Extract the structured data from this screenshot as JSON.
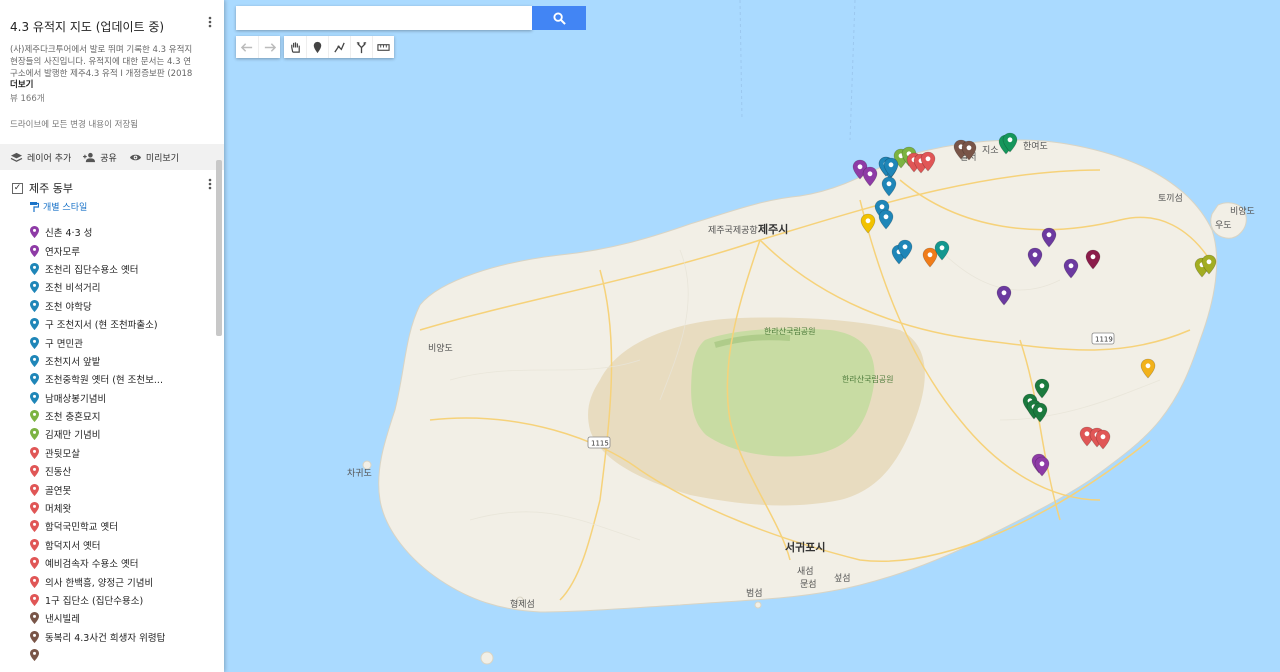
{
  "map_title": "4.3 유적지 지도 (업데이트 중)",
  "description": "(사)제주다크투어에서 발로 뛰며 기록한 4.3 유적지 현장들의 사진입니다. 유적지에 대한 문서는 4.3 연구소에서 발행한 제주4.3 유적 Ⅰ 개정증보판 (2018",
  "more_link": "더보기",
  "views": "뷰 166개",
  "saved_status": "드라이브에 모든 변경 내용이 저장됨",
  "actions": {
    "add_layer": "레이어 추가",
    "share": "공유",
    "preview": "미리보기"
  },
  "layer": {
    "name": "제주 동부",
    "checkbox": "✓",
    "style_link": "개별 스타일"
  },
  "items": [
    {
      "label": "신촌 4·3 성",
      "color": "#8e3ba6"
    },
    {
      "label": "연자모루",
      "color": "#8e3ba6"
    },
    {
      "label": "조천리 집단수용소 옛터",
      "color": "#1f86b8"
    },
    {
      "label": "조천 비석거리",
      "color": "#1f86b8"
    },
    {
      "label": "조천 야학당",
      "color": "#1f86b8"
    },
    {
      "label": "구 조천지서 (현 조천파출소)",
      "color": "#1f86b8"
    },
    {
      "label": "구 면민관",
      "color": "#1f86b8"
    },
    {
      "label": "조천지서 앞밭",
      "color": "#1f86b8"
    },
    {
      "label": "조천중학원 옛터 (현 조천보...",
      "color": "#1f86b8"
    },
    {
      "label": "남매상봉기념비",
      "color": "#1f86b8"
    },
    {
      "label": "조천 충혼묘지",
      "color": "#7cb342"
    },
    {
      "label": "김재만 기념비",
      "color": "#7cb342"
    },
    {
      "label": "관뒷모살",
      "color": "#e05656"
    },
    {
      "label": "진동산",
      "color": "#e05656"
    },
    {
      "label": "골연못",
      "color": "#e05656"
    },
    {
      "label": "머체왓",
      "color": "#e05656"
    },
    {
      "label": "함덕국민학교 옛터",
      "color": "#e05656"
    },
    {
      "label": "함덕지서 옛터",
      "color": "#e05656"
    },
    {
      "label": "예비검속자 수용소 옛터",
      "color": "#e05656"
    },
    {
      "label": "의사 한백흥, 양정근 기념비",
      "color": "#e05656"
    },
    {
      "label": "1구 집단소 (집단수용소)",
      "color": "#e05656"
    },
    {
      "label": "낸시빌레",
      "color": "#795548"
    },
    {
      "label": "동복리 4.3사건 희생자 위령탑",
      "color": "#795548"
    },
    {
      "label": "",
      "color": "#795548"
    }
  ],
  "search": {
    "placeholder": "",
    "value": ""
  },
  "tools": {
    "undo": "undo-icon",
    "redo": "redo-icon",
    "pan": "hand-icon",
    "marker": "marker-icon",
    "line": "draw-line-icon",
    "route": "directions-icon",
    "measure": "ruler-icon"
  },
  "map": {
    "labels": {
      "jeju_city": "제주시",
      "jeju_airport": "제주국제공항",
      "seogwipo": "서귀포시",
      "hallasan_np_1": "한라산국립공원",
      "hallasan_np_2": "한라산국립공원",
      "hamdeok": "함덕",
      "hanyeodo": "한여도",
      "tokkiseom": "토끼섬",
      "biyangdo_e": "비양도",
      "udo": "우도",
      "biyangdo_w": "비양도",
      "chagwido": "차귀도",
      "hyeongjeseom": "형제섬",
      "beomseom": "범섬",
      "munseom": "문섬",
      "seopseom": "섶섬",
      "saeseom": "새섬",
      "road_1115": "1115",
      "road_1119": "1119",
      "partial_a": "달서",
      "partial_b": "지소"
    },
    "markers": [
      {
        "color": "#8e3ba6"
      },
      {
        "color": "#8e3ba6"
      },
      {
        "color": "#1f86b8"
      },
      {
        "color": "#1f86b8"
      },
      {
        "color": "#1f86b8"
      },
      {
        "color": "#1f86b8"
      },
      {
        "color": "#1f86b8"
      },
      {
        "color": "#1f86b8"
      },
      {
        "color": "#1f86b8"
      },
      {
        "color": "#7cb342"
      },
      {
        "color": "#7cb342"
      },
      {
        "color": "#e05656"
      },
      {
        "color": "#e05656"
      },
      {
        "color": "#e05656"
      },
      {
        "color": "#795548"
      },
      {
        "color": "#795548"
      },
      {
        "color": "#15965b"
      },
      {
        "color": "#15965b"
      },
      {
        "color": "#f2c200"
      },
      {
        "color": "#1f86b8"
      },
      {
        "color": "#1f86b8"
      },
      {
        "color": "#f07c1a"
      },
      {
        "color": "#14978f"
      },
      {
        "color": "#6c3aa0"
      },
      {
        "color": "#6c3aa0"
      },
      {
        "color": "#6c3aa0"
      },
      {
        "color": "#8b1c4a"
      },
      {
        "color": "#6c3aa0"
      },
      {
        "color": "#a2ad22"
      },
      {
        "color": "#a2ad22"
      },
      {
        "color": "#f2b21b"
      },
      {
        "color": "#1b7a3e"
      },
      {
        "color": "#1b7a3e"
      },
      {
        "color": "#1b7a3e"
      },
      {
        "color": "#1b7a3e"
      },
      {
        "color": "#e05656"
      },
      {
        "color": "#e05656"
      },
      {
        "color": "#e05656"
      },
      {
        "color": "#8e3ba6"
      },
      {
        "color": "#8e3ba6"
      }
    ]
  }
}
